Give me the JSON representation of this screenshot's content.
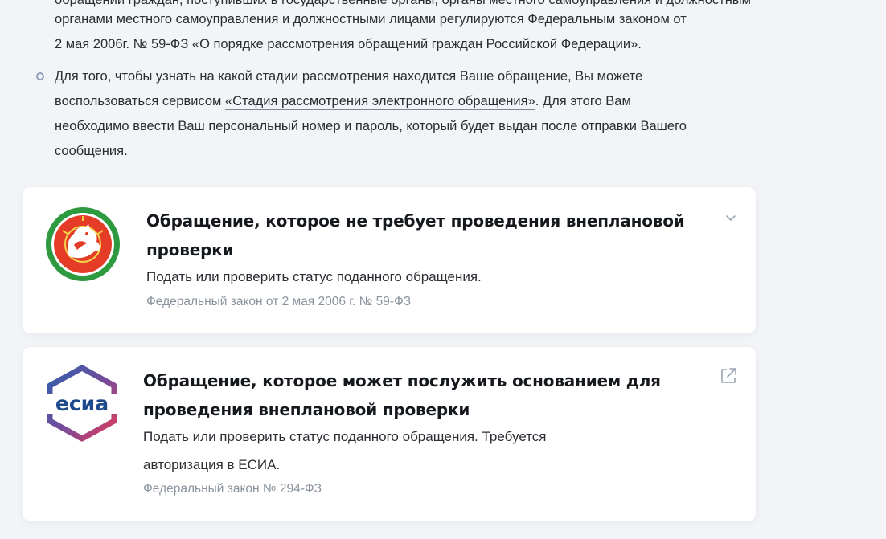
{
  "intro": {
    "cut_line": "обращений граждан, поступивших в государственные органы, органы местного самоуправления и должностным лицам",
    "para1": {
      "line1": "органами местного самоуправления и должностными лицами регулируются Федеральным законом от",
      "line2": "2 мая 2006г. № 59-ФЗ «О порядке рассмотрения обращений граждан Российской Федерации»."
    },
    "para2": {
      "line1": "Для того, чтобы узнать на какой стадии рассмотрения находится Ваше обращение, Вы можете",
      "line2_prefix": "воспользоваться сервисом ",
      "line2_link": "«Стадия рассмотрения электронного обращения»",
      "line2_suffix": ". Для этого Вам",
      "line3": "необходимо ввести Ваш персональный номер и пароль, который будет выдан после отправки Вашего",
      "line4": "сообщения."
    }
  },
  "cards": [
    {
      "logo": "tatarstan-coat-of-arms",
      "title_line1": "Обращение, которое не требует проведения внеплановой",
      "title_line2": "проверки",
      "subtitle": "Подать или проверить статус поданного обращения.",
      "note": "Федеральный закон от 2 мая 2006 г. № 59-ФЗ",
      "action_icon": "chevron-down-icon"
    },
    {
      "logo": "esia-logo",
      "logo_text": "есиа",
      "title_line1": "Обращение, которое может послужить основанием для",
      "title_line2": "проведения внеплановой проверки",
      "subtitle_line1": "Подать или проверить статус поданного обращения. Требуется",
      "subtitle_line2": "авторизация в ЕСИА.",
      "note": "Федеральный закон № 294-ФЗ",
      "action_icon": "external-link-icon"
    }
  ],
  "colors": {
    "page_bg": "#f2f4f7",
    "card_bg": "#ffffff",
    "esia_blue": "#1d4a8c",
    "esia_red": "#e63a58",
    "tat_green": "#2e9a3f",
    "tat_red": "#e43c27"
  }
}
